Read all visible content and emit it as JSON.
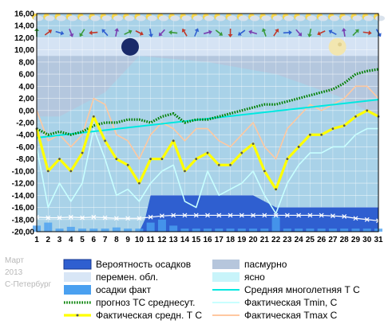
{
  "watermark": {
    "month": "Март",
    "year": "2013",
    "city": "С-Петербург"
  },
  "chart_data": {
    "type": "line",
    "xlim": [
      1,
      31
    ],
    "ylim": [
      -20,
      16
    ],
    "y_ticks": [
      "16,00",
      "14,00",
      "12,00",
      "10,00",
      "8,00",
      "6,00",
      "4,00",
      "2,00",
      "0,00",
      "-2,00",
      "-4,00",
      "-6,00",
      "-8,00",
      "-10,00",
      "-12,00",
      "-14,00",
      "-16,00",
      "-18,00",
      "-20,00"
    ],
    "x_ticks": [
      "1",
      "2",
      "3",
      "4",
      "5",
      "6",
      "7",
      "8",
      "9",
      "10",
      "11",
      "12",
      "13",
      "14",
      "15",
      "16",
      "17",
      "18",
      "19",
      "20",
      "21",
      "22",
      "23",
      "24",
      "25",
      "26",
      "27",
      "28",
      "29",
      "30",
      "31"
    ],
    "grid": true,
    "legend_position": "bottom",
    "colors": {
      "plot_bg": "#a9d2e8",
      "overcast": "#b6c6dc",
      "partly_cloudy": "#d8e6f6",
      "clear": "#c8f4fa",
      "precip_prob": "#2f5fd0",
      "precip_fact": "#4aa0f0",
      "climate_avg": "#00e8e0",
      "forecast": "#008000",
      "actual_avg": "#ffff00",
      "actual_min": "#c8ffff",
      "actual_max": "#ffc8a0"
    },
    "legend": [
      {
        "key": "precip_prob",
        "label": "Вероятность осадков"
      },
      {
        "key": "overcast",
        "label": "пасмурно"
      },
      {
        "key": "partly_cloudy",
        "label": "перемен. обл."
      },
      {
        "key": "clear",
        "label": "ясно"
      },
      {
        "key": "precip_fact",
        "label": "осадки факт"
      },
      {
        "key": "climate_avg",
        "label": "Средняя многолетняя Т С"
      },
      {
        "key": "forecast",
        "label": "прогноз ТС среднесут."
      },
      {
        "key": "actual_min",
        "label": "Фактическая Tmin, С"
      },
      {
        "key": "actual_avg",
        "label": "Фактическая средн. Т С"
      },
      {
        "key": "actual_max",
        "label": "Фактическая Tmax С"
      }
    ],
    "series": [
      {
        "key": "climate_avg",
        "x": [
          1,
          31
        ],
        "values": [
          -4.5,
          1.8
        ]
      },
      {
        "key": "forecast",
        "x": [
          1,
          2,
          3,
          4,
          5,
          6,
          7,
          8,
          9,
          10,
          11,
          12,
          13,
          14,
          15,
          16,
          17,
          18,
          19,
          20,
          21,
          22,
          23,
          24,
          25,
          26,
          27,
          28,
          29,
          30,
          31
        ],
        "values": [
          -3,
          -4,
          -3.5,
          -4,
          -3.5,
          -2.5,
          -2,
          -2,
          -1.5,
          -1.5,
          -2,
          -1,
          -0.5,
          -2,
          -1.5,
          -1.5,
          -1,
          -0.5,
          0,
          0.5,
          1,
          1,
          1.5,
          2,
          2.5,
          3,
          3.5,
          4.5,
          6,
          6.5,
          6.8
        ]
      },
      {
        "key": "actual_avg",
        "x": [
          1,
          2,
          3,
          4,
          5,
          6,
          7,
          8,
          9,
          10,
          11,
          12,
          13,
          14,
          15,
          16,
          17,
          18,
          19,
          20,
          21,
          22,
          23,
          24,
          25,
          26,
          27,
          28,
          29,
          30,
          31
        ],
        "values": [
          -3,
          -10,
          -8,
          -10,
          -7,
          -1,
          -5,
          -8,
          -9,
          -12,
          -8,
          -8,
          -5,
          -10,
          -8,
          -7,
          -9,
          -9,
          -7,
          -5.5,
          -10,
          -13,
          -8,
          -6,
          -4,
          -4,
          -3,
          -2.5,
          -1,
          0,
          -1
        ]
      },
      {
        "key": "actual_min",
        "x": [
          1,
          2,
          3,
          4,
          5,
          6,
          7,
          8,
          9,
          10,
          11,
          12,
          13,
          14,
          15,
          16,
          17,
          18,
          19,
          20,
          21,
          22,
          23,
          24,
          25,
          26,
          27,
          28,
          29,
          30,
          31
        ],
        "values": [
          -6,
          -16,
          -12,
          -15,
          -12,
          -3,
          -8,
          -14,
          -13,
          -15,
          -12,
          -10,
          -9,
          -15,
          -16,
          -10,
          -14,
          -13,
          -12,
          -10,
          -14,
          -17,
          -12,
          -9,
          -7,
          -7,
          -6,
          -6,
          -4,
          -3,
          -3
        ]
      },
      {
        "key": "actual_max",
        "x": [
          1,
          2,
          3,
          4,
          5,
          6,
          7,
          8,
          9,
          10,
          11,
          12,
          13,
          14,
          15,
          16,
          17,
          18,
          19,
          20,
          21,
          22,
          23,
          24,
          25,
          26,
          27,
          28,
          29,
          30,
          31
        ],
        "values": [
          0,
          -5,
          -4,
          -6,
          -4,
          2,
          1,
          -4,
          -5,
          -8,
          -4,
          -2,
          -3,
          -5,
          -3,
          -3,
          -5,
          -6,
          -4,
          -2,
          -6,
          -8,
          -3,
          -1,
          1,
          0,
          1,
          2,
          4,
          4,
          2
        ]
      },
      {
        "key": "precip_prob",
        "x": [
          1,
          10,
          10.5,
          11,
          20,
          22,
          31
        ],
        "values": [
          -20,
          -20,
          -18,
          -14,
          -14,
          -16,
          -16
        ]
      },
      {
        "key": "precip_fact",
        "x": [
          1,
          2,
          3,
          4,
          5,
          6,
          7,
          8,
          9,
          10,
          11,
          12,
          13,
          14,
          15,
          16,
          17,
          18,
          19,
          20,
          21,
          22,
          23,
          24,
          25,
          26,
          27,
          28,
          29,
          30,
          31
        ],
        "values": [
          -19,
          -18.5,
          -19.5,
          -19.2,
          -19.5,
          -19.5,
          -19.5,
          -19.3,
          -19.5,
          -19.5,
          -18.5,
          -18,
          -19,
          -19.5,
          -19.5,
          -19.5,
          -19.5,
          -19.5,
          -19.5,
          -19.5,
          -19.5,
          -17.5,
          -19.5,
          -19.5,
          -19.5,
          -19.5,
          -19.5,
          -19.5,
          -19.5,
          -19.5,
          -19.5
        ]
      },
      {
        "key": "pressure_markers",
        "x": [
          1,
          2,
          3,
          4,
          5,
          6,
          7,
          8,
          9,
          10,
          11,
          12,
          13,
          14,
          15,
          16,
          17,
          18,
          19,
          20,
          21,
          22,
          23,
          24,
          25,
          26,
          27,
          28,
          29,
          30,
          31
        ],
        "values": [
          -17.6,
          -17.7,
          -17.7,
          -17.6,
          -17.7,
          -17.6,
          -17.7,
          -17.8,
          -17.8,
          -17.8,
          -17.6,
          -17.4,
          -17.3,
          -17.3,
          -17.3,
          -17.3,
          -17.3,
          -17.3,
          -17.3,
          -17.3,
          -17.3,
          -17.3,
          -17.3,
          -17.3,
          -17.3,
          -17.3,
          -17.4,
          -17.5,
          -17.8,
          -18,
          -18.2
        ]
      }
    ]
  }
}
